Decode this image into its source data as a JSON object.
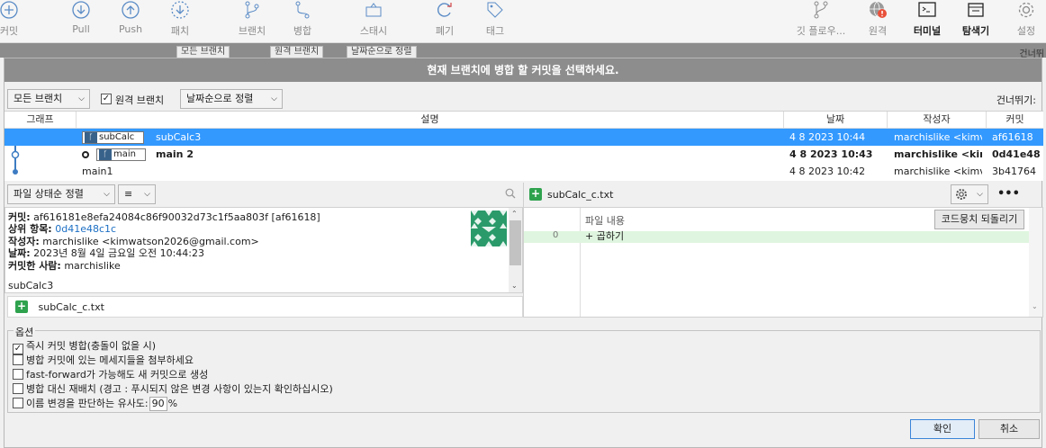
{
  "toolbar": {
    "items": [
      {
        "label": "커밋",
        "icon": "plus-circle-icon"
      },
      {
        "label": "Pull",
        "icon": "arrow-down-circle-icon"
      },
      {
        "label": "Push",
        "icon": "arrow-up-circle-icon"
      },
      {
        "label": "패치",
        "icon": "dashed-arrow-circle-icon"
      },
      {
        "label": "브랜치",
        "icon": "branch-icon"
      },
      {
        "label": "병합",
        "icon": "merge-icon"
      },
      {
        "label": "스태시",
        "icon": "stash-icon"
      },
      {
        "label": "폐기",
        "icon": "discard-icon"
      },
      {
        "label": "태그",
        "icon": "tag-icon"
      },
      {
        "label": "깃 플로우...",
        "icon": "git-flow-icon"
      },
      {
        "label": "원격",
        "icon": "globe-warning-icon"
      },
      {
        "label": "터미널",
        "icon": "terminal-icon"
      },
      {
        "label": "탐색기",
        "icon": "explorer-icon"
      },
      {
        "label": "설정",
        "icon": "gear-icon"
      }
    ]
  },
  "background": {
    "branch_combo": "모든 브랜치",
    "remote_check": "원격 브랜치",
    "sort_combo": "날짜순으로 정렬",
    "skip": "건너뛰"
  },
  "dialog": {
    "title": "현재 브랜치에 병합 할 커밋을 선택하세요.",
    "branch_filter": "모든 브랜치",
    "remote_branches_label": "원격 브랜치",
    "remote_branches_checked": true,
    "sort_label": "날짜순으로 정렬",
    "skip_label": "건너뛰기:"
  },
  "commits": {
    "headers": {
      "graph": "그래프",
      "description": "설명",
      "date": "날짜",
      "author": "작성자",
      "commit": "커밋"
    },
    "rows": [
      {
        "branch_tag": "subCalc",
        "message": "subCalc3",
        "date": "4 8 2023 10:44",
        "author": "marchislike <kimv",
        "hash": "af61618",
        "selected": true,
        "bold": false
      },
      {
        "branch_tag": "main",
        "message": "main 2",
        "date": "4 8 2023 10:43",
        "author": "marchislike <kim",
        "hash": "0d41e48",
        "selected": false,
        "bold": true
      },
      {
        "branch_tag": "",
        "message": "main1",
        "date": "4 8 2023 10:42",
        "author": "marchislike <kimv",
        "hash": "3b41764",
        "selected": false,
        "bold": false
      }
    ]
  },
  "file_panel": {
    "sort_label": "파일 상태순 정렬",
    "view_label": "≡"
  },
  "details": {
    "commit_label": "커밋:",
    "commit_value": "af616181e8efa24084c86f90032d73c1f5aa803f [af61618]",
    "parent_label": "상위 항목:",
    "parent_value": "0d41e48c1c",
    "author_label": "작성자:",
    "author_value": "marchislike <kimwatson2026@gmail.com>",
    "date_label": "날짜:",
    "date_value": "2023년 8월 4일 금요일 오전 10:44:23",
    "committer_label": "커밋한 사람:",
    "committer_value": "marchislike",
    "message": "subCalc3"
  },
  "files": [
    {
      "name": "subCalc_c.txt",
      "status": "added"
    }
  ],
  "diff": {
    "file_name": "subCalc_c.txt",
    "column_label": "파일 내용",
    "revert_button": "코드뭉치 되돌리기",
    "lines": [
      {
        "num": "0",
        "text": "+ 곱하기"
      }
    ]
  },
  "options": {
    "legend": "옵션",
    "items": [
      {
        "label": "즉시 커밋 병합(충돌이 없을 시)",
        "checked": true
      },
      {
        "label": "병합 커밋에 있는 메세지들을 첨부하세요",
        "checked": false
      },
      {
        "label": "fast-forward가 가능해도 새 커밋으로 생성",
        "checked": false
      },
      {
        "label": "병합 대신 재배치 (경고 : 푸시되지 않은 변경 사항이 있는지 확인하십시오)",
        "checked": false
      }
    ],
    "rename_label": "이름 변경을 판단하는 유사도:",
    "rename_value": "90",
    "rename_unit": "%",
    "rename_checked": false
  },
  "buttons": {
    "ok": "확인",
    "cancel": "취소"
  },
  "colors": {
    "selection": "#3399ff",
    "title_bar": "#8d8d8d",
    "added": "#2fa24e",
    "link": "#1c6fc4"
  }
}
